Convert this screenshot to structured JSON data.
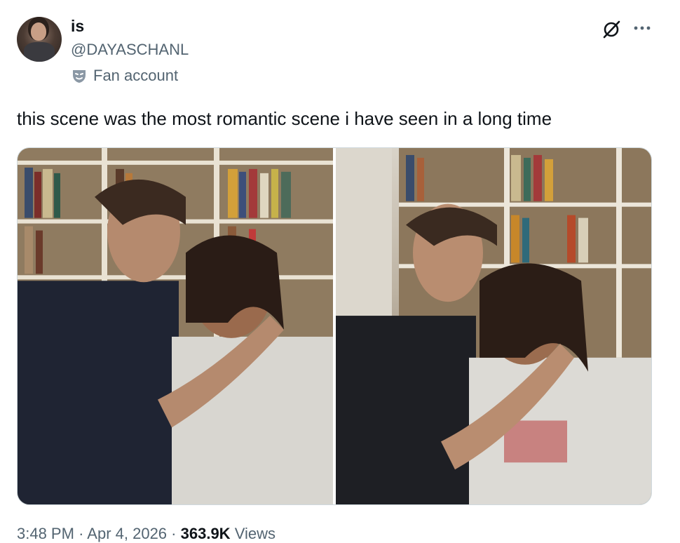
{
  "author": {
    "name": "is",
    "handle": "@DAYASCHANL",
    "badge_label": "Fan account"
  },
  "tweet": {
    "text": "this scene was the most romantic scene i have seen in a long time"
  },
  "meta": {
    "time": "3:48 PM",
    "separator": "·",
    "date": "Apr 4, 2026",
    "views_count": "363.9K",
    "views_label": "Views"
  },
  "icons": {
    "badge": "theater-mask-icon",
    "grok": "grok-icon",
    "more": "more-options-icon"
  },
  "colors": {
    "text_primary": "#0f1419",
    "text_secondary": "#536471",
    "border": "#cfd9de"
  }
}
